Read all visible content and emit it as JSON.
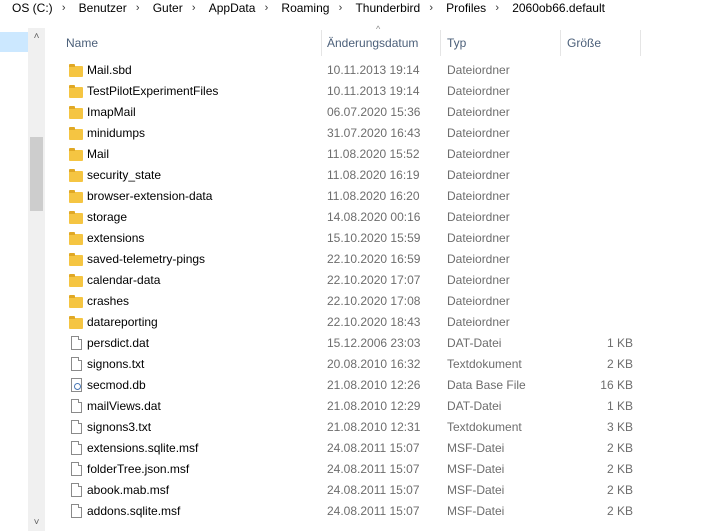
{
  "breadcrumb": [
    "OS (C:)",
    "Benutzer",
    "Guter",
    "AppData",
    "Roaming",
    "Thunderbird",
    "Profiles",
    "2060ob66.default"
  ],
  "breadcrumb_separator": "›",
  "columns": {
    "name": "Name",
    "date": "Änderungsdatum",
    "type": "Typ",
    "size": "Größe"
  },
  "sort_indicator": "^",
  "scroll": {
    "up": "˄",
    "down": "˅"
  },
  "files": [
    {
      "name": "Mail.sbd",
      "date": "10.11.2013 19:14",
      "type": "Dateiordner",
      "size": "",
      "icon": "folder-icon"
    },
    {
      "name": "TestPilotExperimentFiles",
      "date": "10.11.2013 19:14",
      "type": "Dateiordner",
      "size": "",
      "icon": "folder-icon"
    },
    {
      "name": "ImapMail",
      "date": "06.07.2020 15:36",
      "type": "Dateiordner",
      "size": "",
      "icon": "folder-icon"
    },
    {
      "name": "minidumps",
      "date": "31.07.2020 16:43",
      "type": "Dateiordner",
      "size": "",
      "icon": "folder-icon"
    },
    {
      "name": "Mail",
      "date": "11.08.2020 15:52",
      "type": "Dateiordner",
      "size": "",
      "icon": "folder-icon"
    },
    {
      "name": "security_state",
      "date": "11.08.2020 16:19",
      "type": "Dateiordner",
      "size": "",
      "icon": "folder-icon"
    },
    {
      "name": "browser-extension-data",
      "date": "11.08.2020 16:20",
      "type": "Dateiordner",
      "size": "",
      "icon": "folder-icon"
    },
    {
      "name": "storage",
      "date": "14.08.2020 00:16",
      "type": "Dateiordner",
      "size": "",
      "icon": "folder-icon"
    },
    {
      "name": "extensions",
      "date": "15.10.2020 15:59",
      "type": "Dateiordner",
      "size": "",
      "icon": "folder-icon"
    },
    {
      "name": "saved-telemetry-pings",
      "date": "22.10.2020 16:59",
      "type": "Dateiordner",
      "size": "",
      "icon": "folder-icon"
    },
    {
      "name": "calendar-data",
      "date": "22.10.2020 17:07",
      "type": "Dateiordner",
      "size": "",
      "icon": "folder-icon"
    },
    {
      "name": "crashes",
      "date": "22.10.2020 17:08",
      "type": "Dateiordner",
      "size": "",
      "icon": "folder-icon"
    },
    {
      "name": "datareporting",
      "date": "22.10.2020 18:43",
      "type": "Dateiordner",
      "size": "",
      "icon": "folder-icon"
    },
    {
      "name": "persdict.dat",
      "date": "15.12.2006 23:03",
      "type": "DAT-Datei",
      "size": "1 KB",
      "icon": "file-icon"
    },
    {
      "name": "signons.txt",
      "date": "20.08.2010 16:32",
      "type": "Textdokument",
      "size": "2 KB",
      "icon": "file-icon"
    },
    {
      "name": "secmod.db",
      "date": "21.08.2010 12:26",
      "type": "Data Base File",
      "size": "16 KB",
      "icon": "database-file-icon"
    },
    {
      "name": "mailViews.dat",
      "date": "21.08.2010 12:29",
      "type": "DAT-Datei",
      "size": "1 KB",
      "icon": "file-icon"
    },
    {
      "name": "signons3.txt",
      "date": "21.08.2010 12:31",
      "type": "Textdokument",
      "size": "3 KB",
      "icon": "file-icon"
    },
    {
      "name": "extensions.sqlite.msf",
      "date": "24.08.2011 15:07",
      "type": "MSF-Datei",
      "size": "2 KB",
      "icon": "file-icon"
    },
    {
      "name": "folderTree.json.msf",
      "date": "24.08.2011 15:07",
      "type": "MSF-Datei",
      "size": "2 KB",
      "icon": "file-icon"
    },
    {
      "name": "abook.mab.msf",
      "date": "24.08.2011 15:07",
      "type": "MSF-Datei",
      "size": "2 KB",
      "icon": "file-icon"
    },
    {
      "name": "addons.sqlite.msf",
      "date": "24.08.2011 15:07",
      "type": "MSF-Datei",
      "size": "2 KB",
      "icon": "file-icon"
    }
  ]
}
